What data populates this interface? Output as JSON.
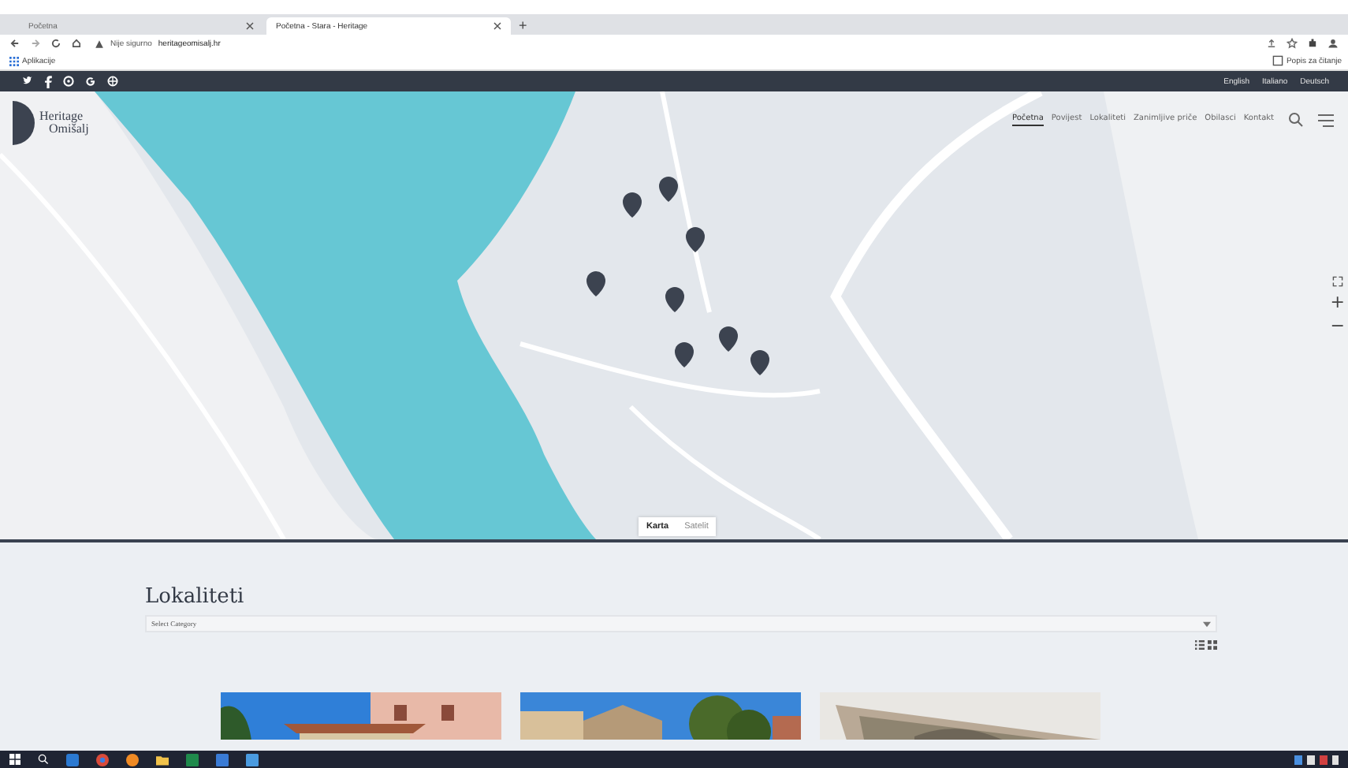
{
  "browser": {
    "tabs": [
      {
        "label": "Početna",
        "selected": false
      },
      {
        "label": "Početna - Stara - Heritage",
        "selected": true
      }
    ],
    "new_tab": "+",
    "address": {
      "security": "Nije sigurno",
      "url": "heritageomisalj.hr"
    },
    "bookmarks": [
      {
        "label": "Aplikacije"
      }
    ],
    "reading_list": "Popis za čitanje"
  },
  "topbar": {
    "languages": [
      "English",
      "Italiano",
      "Deutsch"
    ]
  },
  "logo": {
    "line1": "Heritage",
    "line2": "Omišalj"
  },
  "nav": [
    {
      "label": "Početna",
      "selected": true
    },
    {
      "label": "Povijest",
      "selected": false
    },
    {
      "label": "Lokaliteti",
      "selected": false
    },
    {
      "label": "Zanimljive priče",
      "selected": false
    },
    {
      "label": "Obilasci",
      "selected": false
    },
    {
      "label": "Kontakt",
      "selected": false
    }
  ],
  "map": {
    "types": [
      {
        "label": "Karta",
        "selected": true
      },
      {
        "label": "Satelit",
        "selected": false
      }
    ],
    "zoom_in": "+",
    "zoom_out": "−"
  },
  "section": {
    "title": "Lokaliteti",
    "category": {
      "placeholder": "Select Category"
    }
  }
}
